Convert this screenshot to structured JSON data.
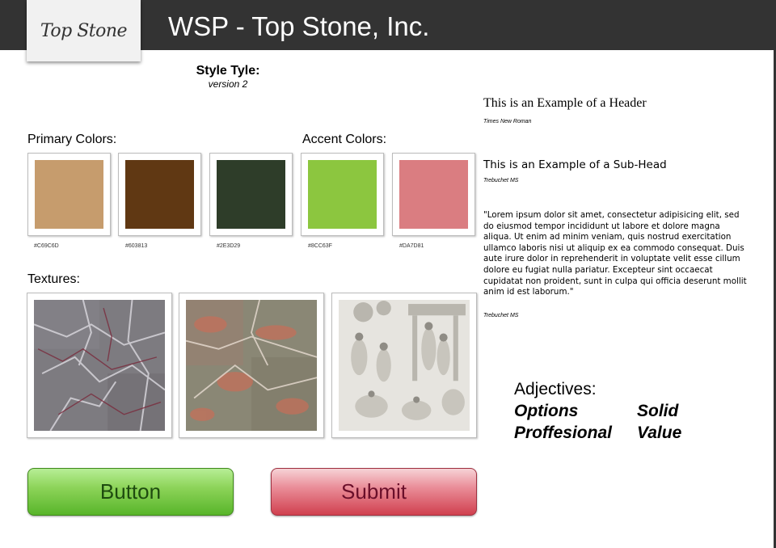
{
  "header": {
    "logo_text": "Top Stone",
    "title": "WSP - Top Stone, Inc."
  },
  "style": {
    "title": "Style Tyle:",
    "subtitle": "version 2"
  },
  "primary_colors": {
    "label": "Primary Colors:",
    "swatches": [
      {
        "hex": "#C69C6D",
        "label": "#C69C6D"
      },
      {
        "hex": "#603813",
        "label": "#603813"
      },
      {
        "hex": "#2E3D29",
        "label": "#2E3D29"
      }
    ]
  },
  "accent_colors": {
    "label": "Accent Colors:",
    "swatches": [
      {
        "hex": "#8CC63F",
        "label": "#8CC63F"
      },
      {
        "hex": "#DA7D81",
        "label": "#DA7D81"
      }
    ]
  },
  "textures": {
    "label": "Textures:",
    "items": [
      "grey-marble-texture",
      "pink-marble-texture",
      "carved-relief-texture"
    ]
  },
  "buttons": {
    "primary": "Button",
    "submit": "Submit"
  },
  "typography": {
    "header_example": "This is an Example of a Header",
    "header_font": "Times New Roman",
    "subhead_example": "This is an Example of a Sub-Head",
    "subhead_font": "Trebuchet MS",
    "body_example": "\"Lorem ipsum dolor sit amet, consectetur adipisicing elit, sed do eiusmod tempor incididunt ut labore et dolore magna aliqua. Ut enim ad minim veniam, quis nostrud exercitation ullamco laboris nisi ut aliquip ex ea commodo consequat. Duis aute irure dolor in reprehenderit in voluptate velit esse cillum dolore eu fugiat nulla pariatur. Excepteur sint occaecat cupidatat non proident, sunt in culpa qui officia deserunt mollit anim id est laborum.\"",
    "body_font": "Trebuchet MS"
  },
  "adjectives": {
    "title": "Adjectives:",
    "items": [
      "Options",
      "Proffesional",
      "Solid",
      "Value"
    ]
  }
}
